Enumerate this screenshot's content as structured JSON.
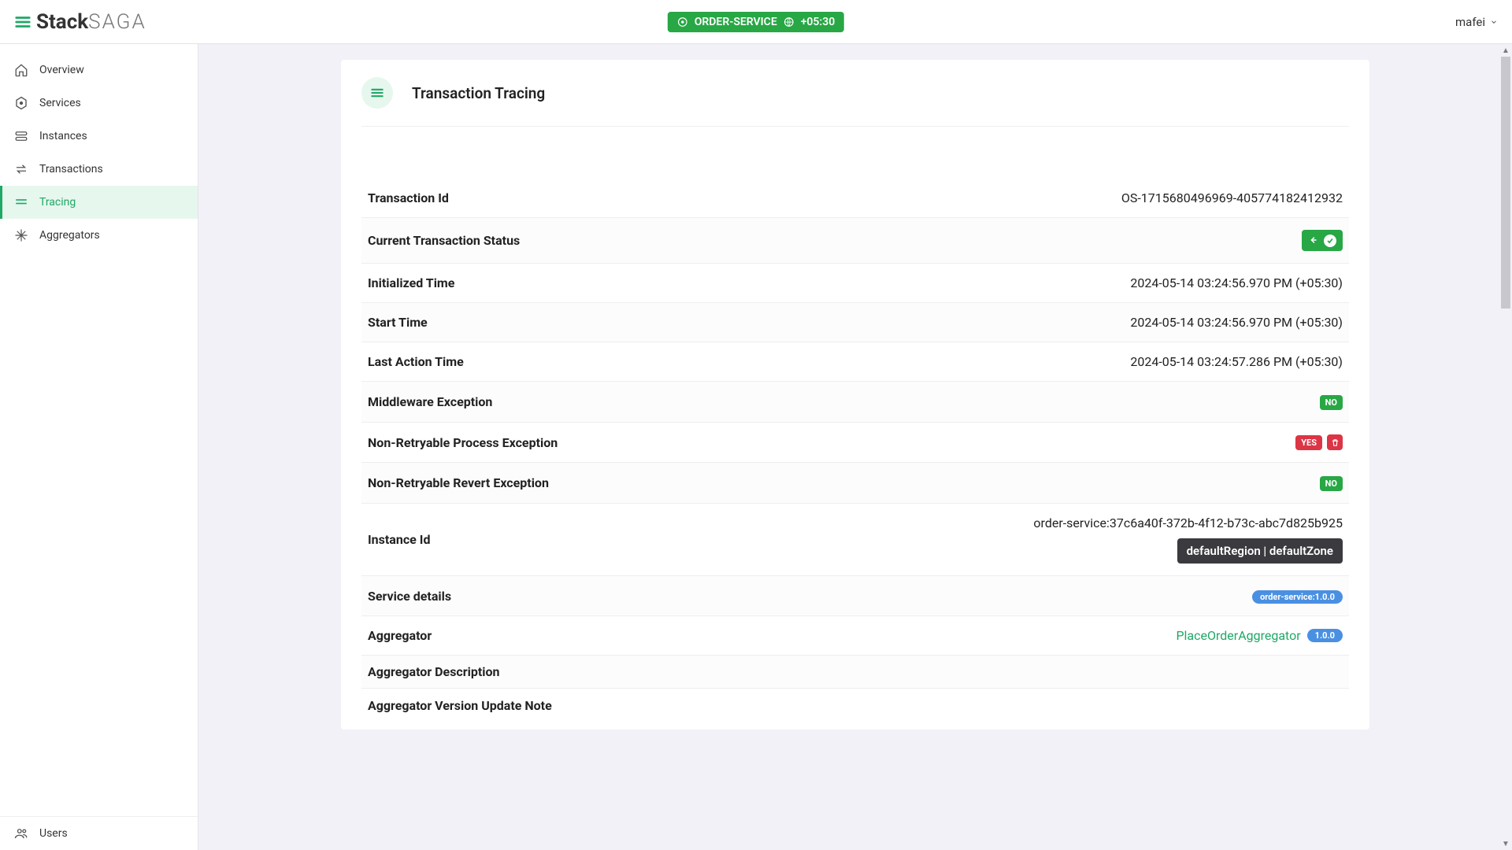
{
  "brand": {
    "stack": "Stack",
    "saga": "SAGA"
  },
  "header": {
    "service_name": "ORDER-SERVICE",
    "timezone": "+05:30",
    "user": "mafei"
  },
  "sidebar": {
    "items": [
      {
        "label": "Overview"
      },
      {
        "label": "Services"
      },
      {
        "label": "Instances"
      },
      {
        "label": "Transactions"
      },
      {
        "label": "Tracing"
      },
      {
        "label": "Aggregators"
      }
    ],
    "bottom": {
      "label": "Users"
    }
  },
  "page": {
    "title": "Transaction Tracing",
    "fields": {
      "transaction_id": {
        "label": "Transaction Id",
        "value": "OS-1715680496969-405774182412932"
      },
      "status": {
        "label": "Current Transaction Status"
      },
      "init_time": {
        "label": "Initialized Time",
        "value": "2024-05-14 03:24:56.970 PM (+05:30)"
      },
      "start_time": {
        "label": "Start Time",
        "value": "2024-05-14 03:24:56.970 PM (+05:30)"
      },
      "last_time": {
        "label": "Last Action Time",
        "value": "2024-05-14 03:24:57.286 PM (+05:30)"
      },
      "mw_ex": {
        "label": "Middleware Exception",
        "badge": "NO"
      },
      "nrp_ex": {
        "label": "Non-Retryable Process Exception",
        "badge": "YES"
      },
      "nrr_ex": {
        "label": "Non-Retryable Revert Exception",
        "badge": "NO"
      },
      "instance": {
        "label": "Instance Id",
        "value": "order-service:37c6a40f-372b-4f12-b73c-abc7d825b925",
        "region": "defaultRegion | defaultZone"
      },
      "service": {
        "label": "Service details",
        "value": "order-service:1.0.0"
      },
      "aggregator": {
        "label": "Aggregator",
        "name": "PlaceOrderAggregator",
        "version": "1.0.0"
      },
      "agg_desc": {
        "label": "Aggregator Description"
      },
      "agg_note": {
        "label": "Aggregator Version Update Note"
      }
    }
  }
}
